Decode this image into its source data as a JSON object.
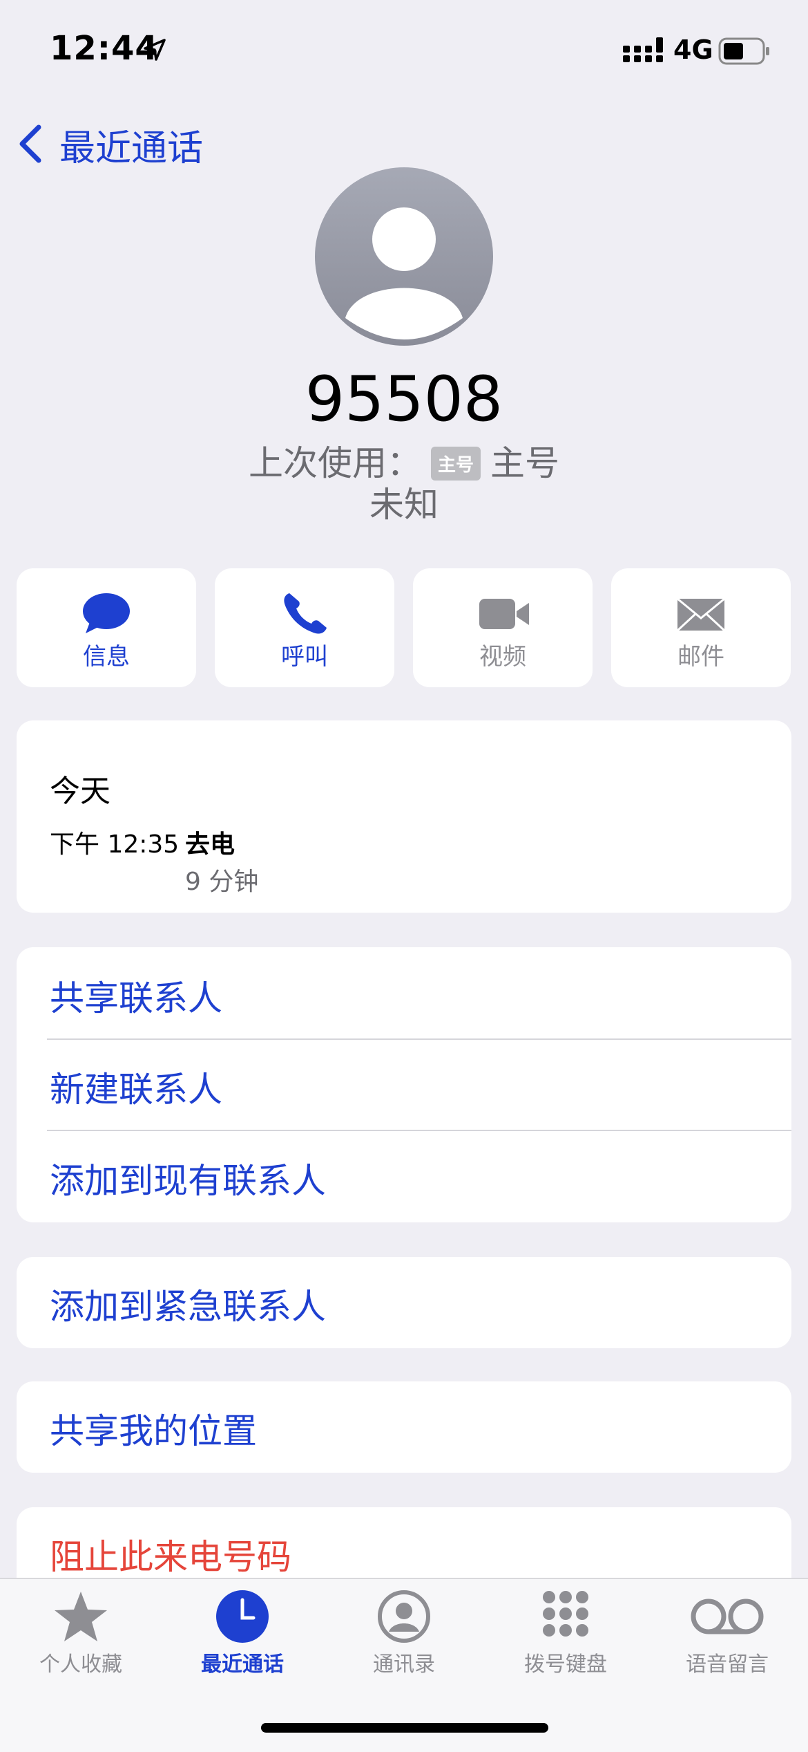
{
  "status_bar": {
    "time": "12:44",
    "network": "4G"
  },
  "header": {
    "back_label": "最近通话"
  },
  "contact": {
    "number": "95508",
    "last_used_prefix": "上次使用：",
    "sim_badge": "主号",
    "sim_name": "主号",
    "location": "未知"
  },
  "actions": [
    {
      "label": "信息",
      "icon": "message-icon",
      "enabled": true
    },
    {
      "label": "呼叫",
      "icon": "phone-icon",
      "enabled": true
    },
    {
      "label": "视频",
      "icon": "video-icon",
      "enabled": false
    },
    {
      "label": "邮件",
      "icon": "mail-icon",
      "enabled": false
    }
  ],
  "history": {
    "date": "今天",
    "time": "下午 12:35",
    "type": "去电",
    "duration": "9 分钟"
  },
  "options_group1": [
    "共享联系人",
    "新建联系人",
    "添加到现有联系人"
  ],
  "options_group2": [
    "添加到紧急联系人"
  ],
  "options_group3": [
    "共享我的位置"
  ],
  "options_group4": [
    "阻止此来电号码"
  ],
  "tabs": [
    {
      "label": "个人收藏",
      "icon": "star-icon",
      "active": false
    },
    {
      "label": "最近通话",
      "icon": "clock-icon",
      "active": true
    },
    {
      "label": "通讯录",
      "icon": "contacts-icon",
      "active": false
    },
    {
      "label": "拨号键盘",
      "icon": "keypad-icon",
      "active": false
    },
    {
      "label": "语音留言",
      "icon": "voicemail-icon",
      "active": false
    }
  ],
  "colors": {
    "accent": "#1E40D0",
    "destructive": "#E5453A",
    "background": "#EFEEF4"
  }
}
